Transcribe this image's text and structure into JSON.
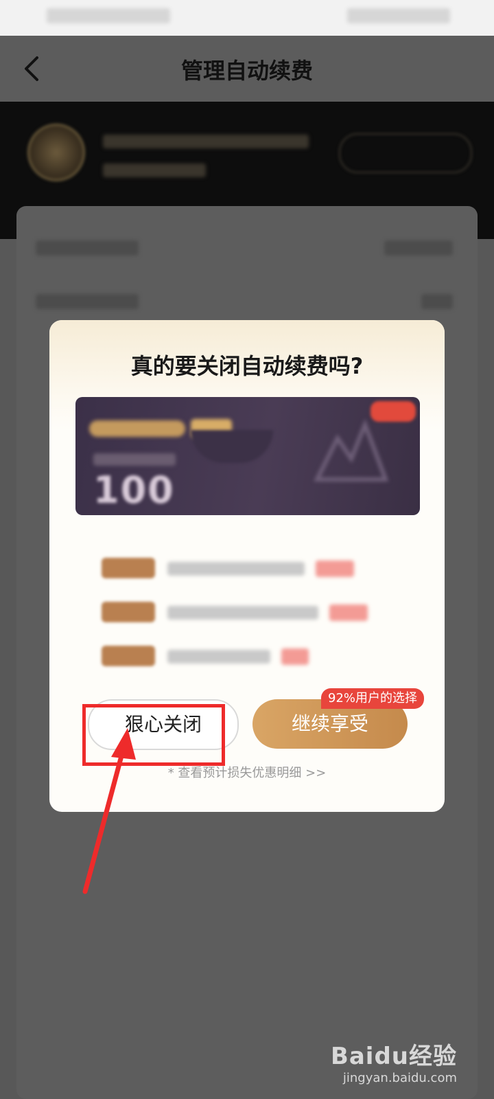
{
  "nav": {
    "title": "管理自动续费"
  },
  "modal": {
    "title": "真的要关闭自动续费吗?",
    "vip_card": {
      "amount": "100"
    },
    "close_button": "狠心关闭",
    "continue_button": "继续享受",
    "choice_badge": "92%用户的选择",
    "detail_link": "* 查看预计损失优惠明细 >>"
  },
  "watermark": {
    "logo": "Baidu经验",
    "url": "jingyan.baidu.com"
  },
  "colors": {
    "accent_gold": "#c58a4c",
    "badge_red": "#e8453c",
    "annotation_red": "#ee2b2b"
  }
}
